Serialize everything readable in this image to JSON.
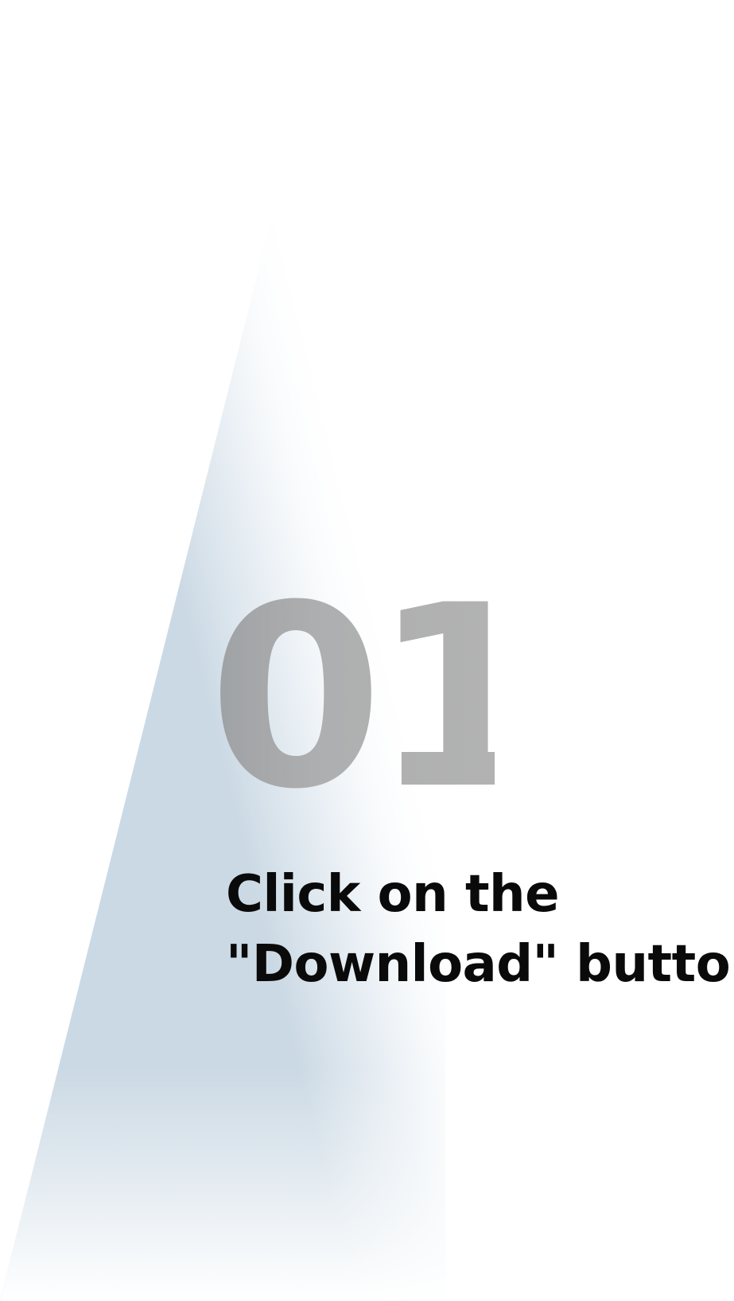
{
  "step": {
    "number": "01",
    "title_line1": "Click on the",
    "title_line2": "\"Download\" button"
  },
  "colors": {
    "background": "#ffffff",
    "wedge_shade": "#cfdce6",
    "number_gray": "#b2b2b2",
    "title_text": "#0a0a0a"
  }
}
